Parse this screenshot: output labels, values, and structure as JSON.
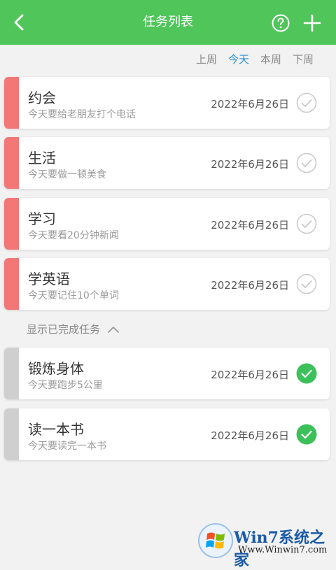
{
  "header": {
    "title": "任务列表"
  },
  "filters": [
    "上周",
    "今天",
    "本周",
    "下周"
  ],
  "filters_active": "今天",
  "tasks": [
    {
      "title": "约会",
      "subtitle": "今天要给老朋友打个电话",
      "date": "2022年6月26日",
      "done": false
    },
    {
      "title": "生活",
      "subtitle": "今天要做一顿美食",
      "date": "2022年6月26日",
      "done": false
    },
    {
      "title": "学习",
      "subtitle": "今天要看20分钟新闻",
      "date": "2022年6月26日",
      "done": false
    },
    {
      "title": "学英语",
      "subtitle": "今天要记住10个单词",
      "date": "2022年6月26日",
      "done": false
    }
  ],
  "show_done_label": "显示已完成任务",
  "done_tasks": [
    {
      "title": "锻炼身体",
      "subtitle": "今天要跑步5公里",
      "date": "2022年6月26日",
      "done": true
    },
    {
      "title": "读一本书",
      "subtitle": "今天要读完一本书",
      "date": "2022年6月26日",
      "done": true
    }
  ],
  "watermark": {
    "title": "Win7系统之家",
    "url": "Www.Winwin7.com"
  },
  "colors": {
    "header": "#4fc55a",
    "active_filter": "#2a8fd8",
    "pending_stripe": "#f37777",
    "done_stripe": "#cfcfcf",
    "done_check": "#3cc15a"
  },
  "icons": {
    "back": "chevron-left-icon",
    "help": "question-circle-icon",
    "add": "plus-icon",
    "pending": "check-circle-outline-icon",
    "done": "check-circle-filled-icon",
    "expand": "chevron-up-icon"
  }
}
